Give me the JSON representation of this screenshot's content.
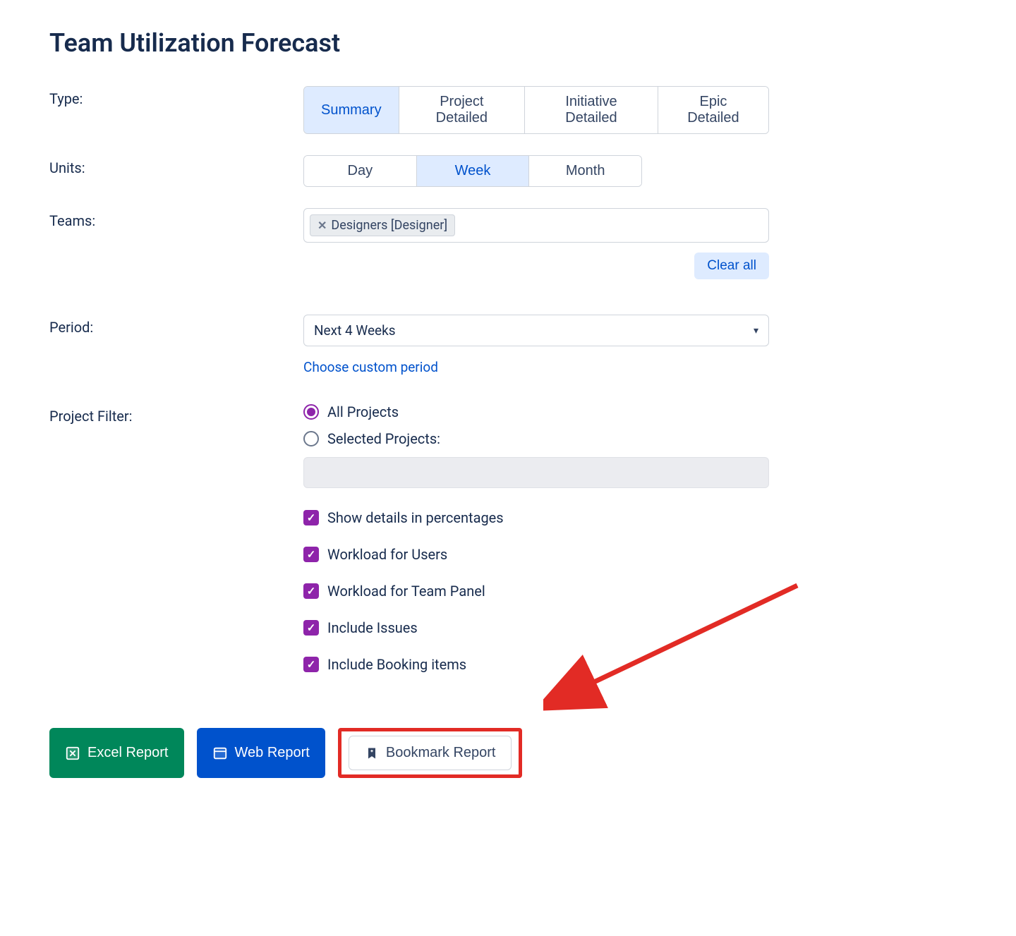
{
  "title": "Team Utilization Forecast",
  "labels": {
    "type": "Type:",
    "units": "Units:",
    "teams": "Teams:",
    "period": "Period:",
    "project_filter": "Project Filter:"
  },
  "type_options": {
    "summary": "Summary",
    "project_detailed": "Project Detailed",
    "initiative_detailed": "Initiative Detailed",
    "epic_detailed": "Epic Detailed"
  },
  "units_options": {
    "day": "Day",
    "week": "Week",
    "month": "Month"
  },
  "teams": {
    "tags": [
      "Designers [Designer]"
    ],
    "clear_all": "Clear all"
  },
  "period": {
    "selected": "Next 4 Weeks",
    "custom_link": "Choose custom period"
  },
  "project_filter": {
    "all": "All Projects",
    "selected": "Selected Projects:"
  },
  "checkboxes": {
    "percentages": "Show details in percentages",
    "workload_users": "Workload for Users",
    "workload_team": "Workload for Team Panel",
    "include_issues": "Include Issues",
    "include_booking": "Include Booking items"
  },
  "buttons": {
    "excel": "Excel Report",
    "web": "Web Report",
    "bookmark": "Bookmark Report"
  }
}
